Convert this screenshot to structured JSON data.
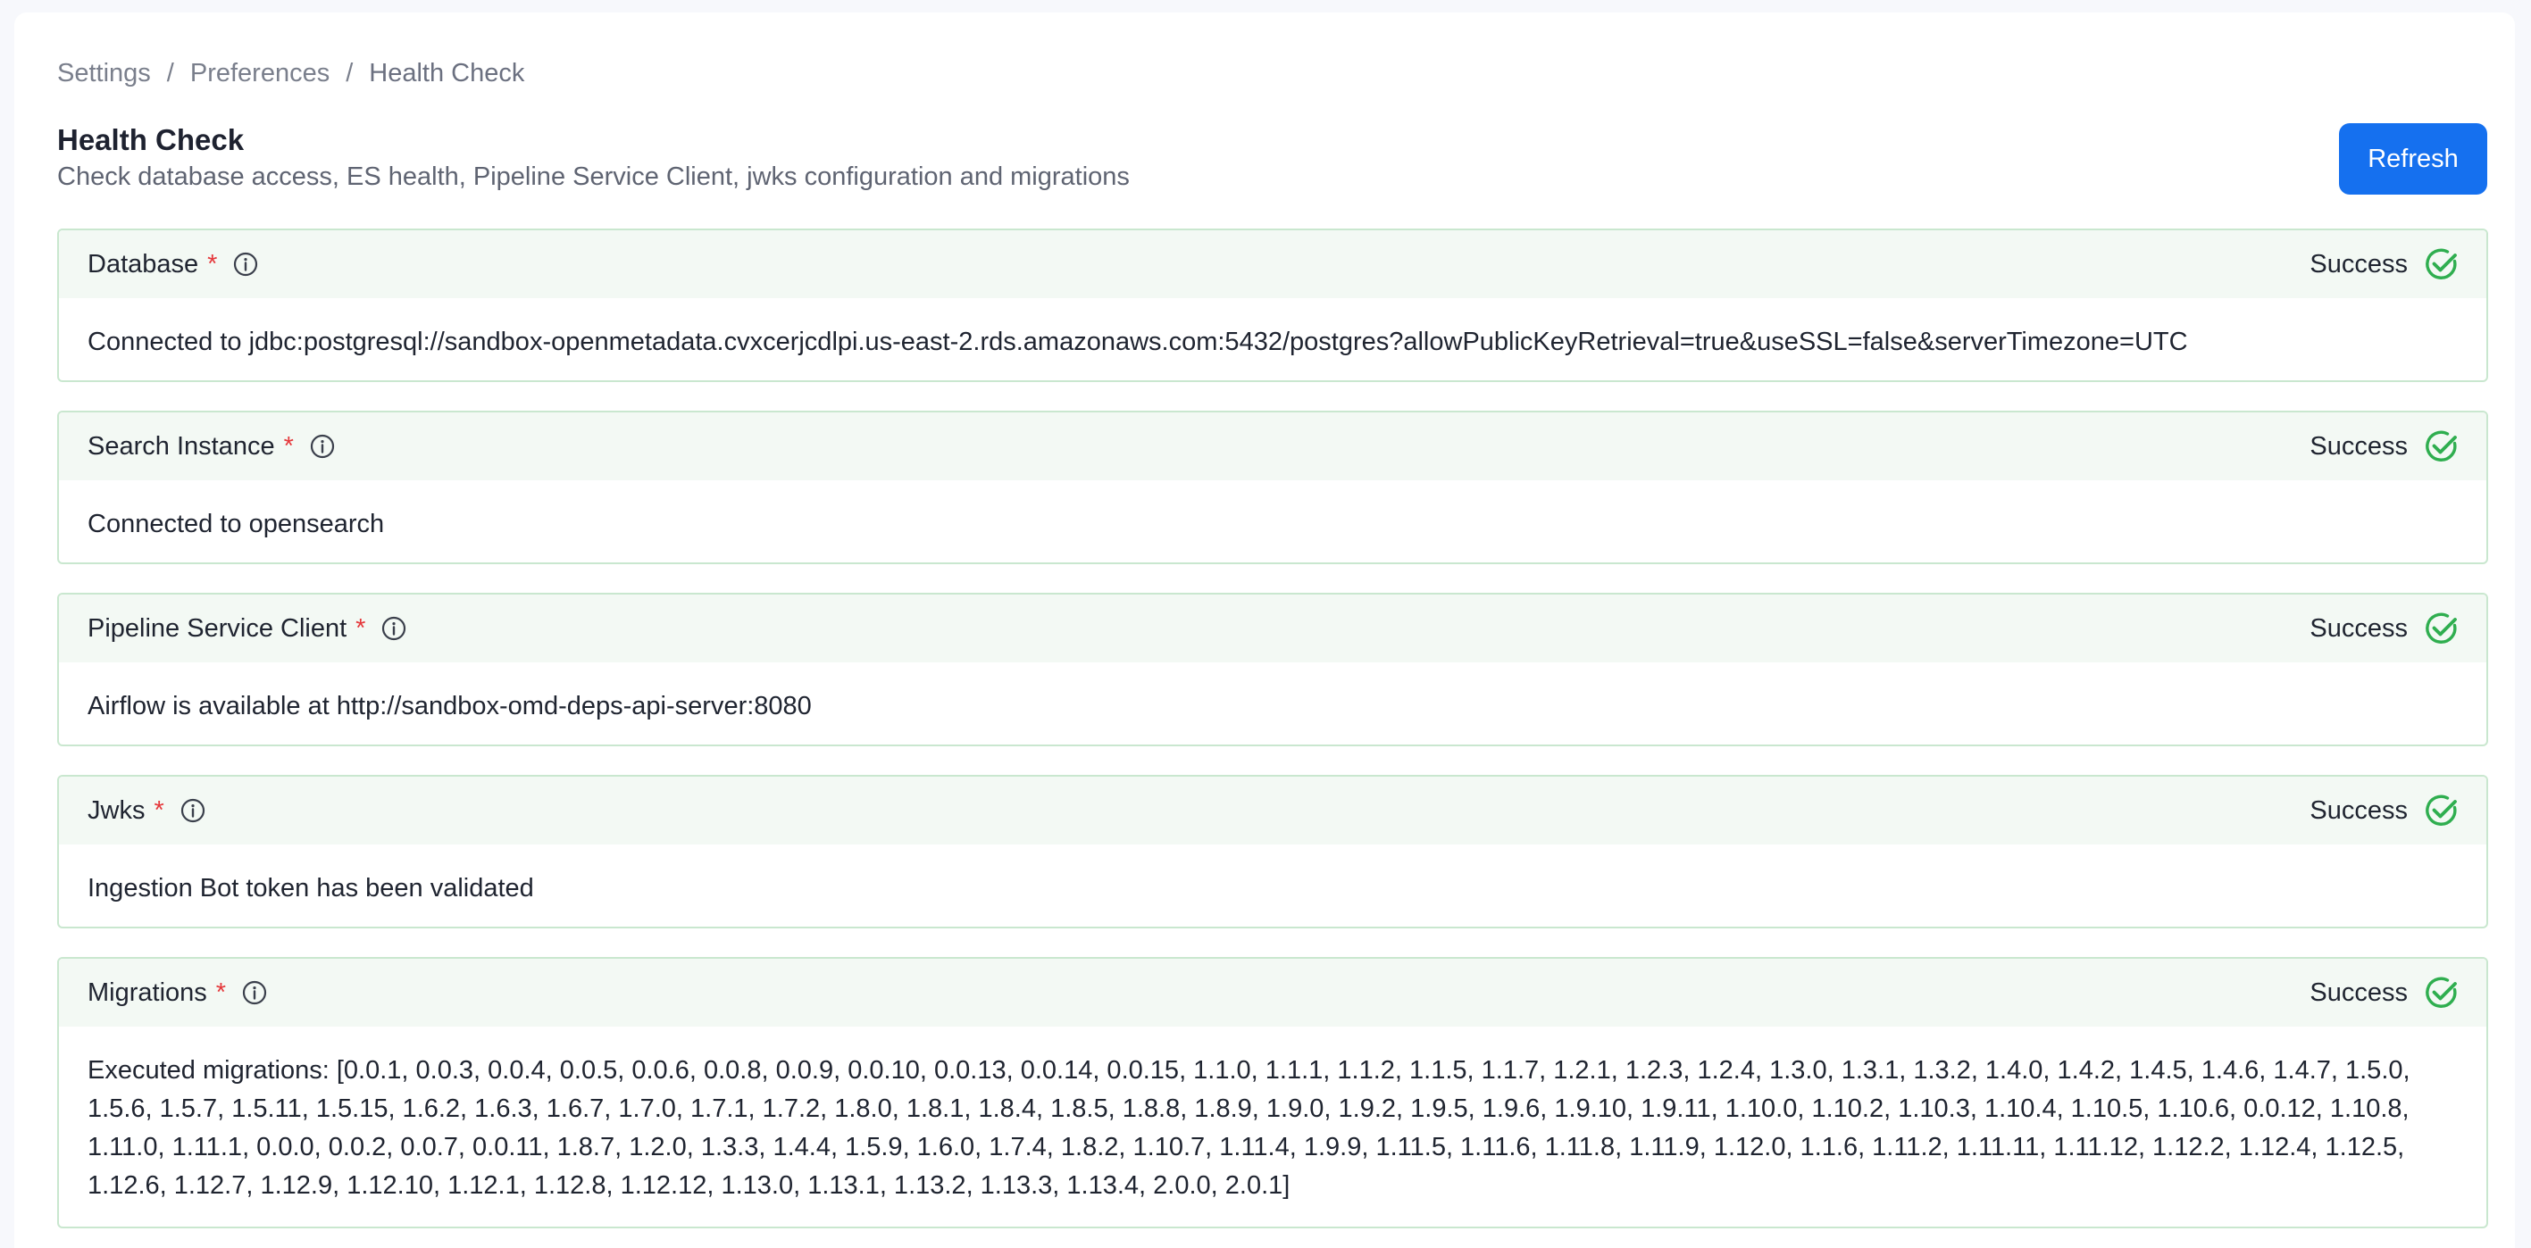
{
  "breadcrumb": [
    {
      "label": "Settings"
    },
    {
      "label": "Preferences"
    },
    {
      "label": "Health Check"
    }
  ],
  "breadcrumb_separator": "/",
  "header": {
    "title": "Health Check",
    "subtitle": "Check database access, ES health, Pipeline Service Client, jwks configuration and migrations",
    "refresh_label": "Refresh"
  },
  "colors": {
    "accent": "#1570ef",
    "success": "#2fae4f",
    "required": "#e5383b",
    "card_border": "#c9e7cf",
    "card_header_bg": "#f3f9f4"
  },
  "checks": [
    {
      "name": "Database",
      "required_mark": "*",
      "status": "Success",
      "icon": "check-circle-icon",
      "message": "Connected to jdbc:postgresql://sandbox-openmetadata.cvxcerjcdlpi.us-east-2.rds.amazonaws.com:5432/postgres?allowPublicKeyRetrieval=true&useSSL=false&serverTimezone=UTC"
    },
    {
      "name": "Search Instance",
      "required_mark": "*",
      "status": "Success",
      "icon": "check-circle-icon",
      "message": "Connected to opensearch"
    },
    {
      "name": "Pipeline Service Client",
      "required_mark": "*",
      "status": "Success",
      "icon": "check-circle-icon",
      "message": "Airflow is available at http://sandbox-omd-deps-api-server:8080"
    },
    {
      "name": "Jwks",
      "required_mark": "*",
      "status": "Success",
      "icon": "check-circle-icon",
      "message": "Ingestion Bot token has been validated"
    },
    {
      "name": "Migrations",
      "required_mark": "*",
      "status": "Success",
      "icon": "check-circle-icon",
      "message": "Executed migrations: [0.0.1, 0.0.3, 0.0.4, 0.0.5, 0.0.6, 0.0.8, 0.0.9, 0.0.10, 0.0.13, 0.0.14, 0.0.15, 1.1.0, 1.1.1, 1.1.2, 1.1.5, 1.1.7, 1.2.1, 1.2.3, 1.2.4, 1.3.0, 1.3.1, 1.3.2, 1.4.0, 1.4.2, 1.4.5, 1.4.6, 1.4.7, 1.5.0, 1.5.6, 1.5.7, 1.5.11, 1.5.15, 1.6.2, 1.6.3, 1.6.7, 1.7.0, 1.7.1, 1.7.2, 1.8.0, 1.8.1, 1.8.4, 1.8.5, 1.8.8, 1.8.9, 1.9.0, 1.9.2, 1.9.5, 1.9.6, 1.9.10, 1.9.11, 1.10.0, 1.10.2, 1.10.3, 1.10.4, 1.10.5, 1.10.6, 0.0.12, 1.10.8, 1.11.0, 1.11.1, 0.0.0, 0.0.2, 0.0.7, 0.0.11, 1.8.7, 1.2.0, 1.3.3, 1.4.4, 1.5.9, 1.6.0, 1.7.4, 1.8.2, 1.10.7, 1.11.4, 1.9.9, 1.11.5, 1.11.6, 1.11.8, 1.11.9, 1.12.0, 1.1.6, 1.11.2, 1.11.11, 1.11.12, 1.12.2, 1.12.4, 1.12.5, 1.12.6, 1.12.7, 1.12.9, 1.12.10, 1.12.1, 1.12.8, 1.12.12, 1.13.0, 1.13.1, 1.13.2, 1.13.3, 1.13.4, 2.0.0, 2.0.1]"
    }
  ]
}
